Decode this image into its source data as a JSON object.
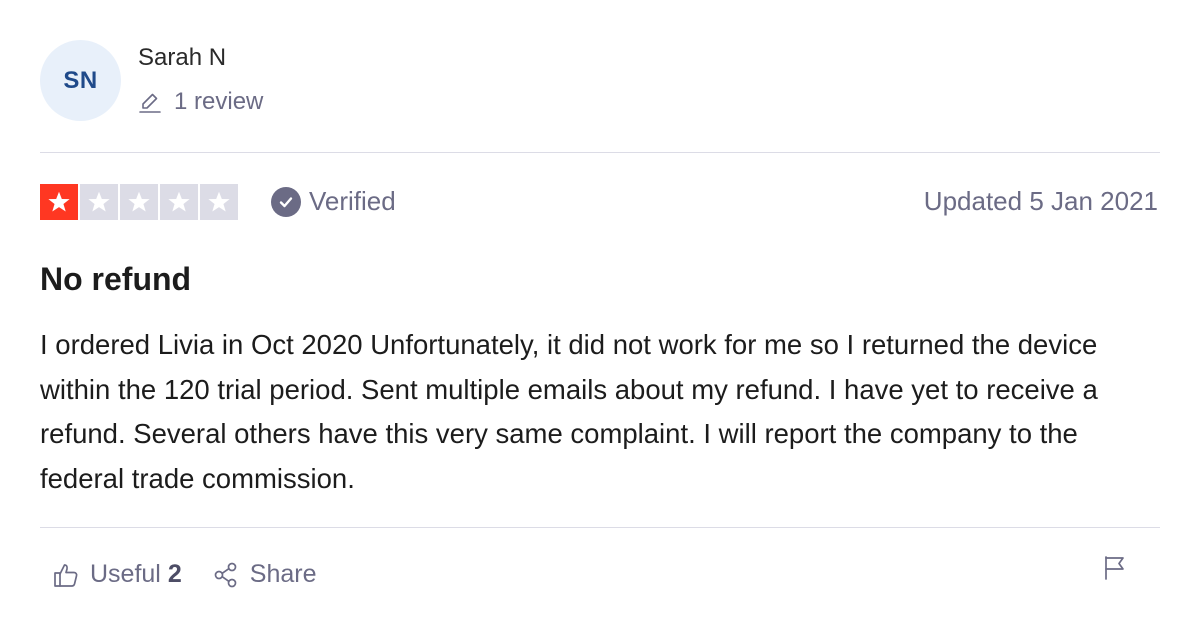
{
  "consumer": {
    "initials": "SN",
    "name": "Sarah N",
    "review_count": "1 review"
  },
  "review": {
    "rating": 1,
    "max_rating": 5,
    "verified_label": "Verified",
    "date": "Updated 5 Jan 2021",
    "title": "No refund",
    "body": "I ordered Livia in Oct 2020 Unfortunately, it did not work for me so I returned the device within the 120 trial period. Sent multiple emails about my refund. I have yet to receive a refund. Several others have this very same complaint. I will report the company to the federal trade commission."
  },
  "actions": {
    "useful_label": "Useful",
    "useful_count": "2",
    "share_label": "Share"
  },
  "icons": {
    "pencil": "pencil-icon",
    "star": "star-icon",
    "check": "check-icon",
    "thumbs_up": "thumbs-up-icon",
    "share": "share-icon",
    "flag": "flag-icon"
  },
  "colors": {
    "star_filled": "#ff3722",
    "star_empty": "#dcdce6",
    "muted_text": "#6b6b85",
    "avatar_bg": "#e8f0fa",
    "avatar_text": "#1f4a8a"
  }
}
